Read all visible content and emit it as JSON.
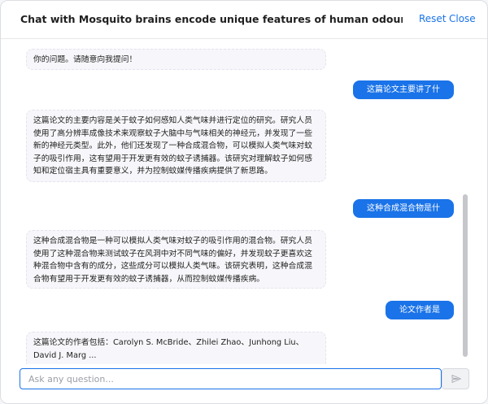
{
  "header": {
    "title": "Chat with Mosquito brains encode unique features of human odour to drive host seeking...",
    "reset_label": "Reset",
    "close_label": "Close"
  },
  "messages": [
    {
      "role": "assistant",
      "text": "你的问题。请随意向我提问！"
    },
    {
      "role": "user",
      "text": "这篇论文主要讲了什么？"
    },
    {
      "role": "assistant",
      "text": "这篇论文的主要内容是关于蚊子如何感知人类气味并进行定位的研究。研究人员使用了高分辨率成像技术来观察蚊子大脑中与气味相关的神经元，并发现了一些新的神经元类型。此外，他们还发现了一种合成混合物，可以模拟人类气味对蚊子的吸引作用，这有望用于开发更有效的蚊子诱捕器。该研究对理解蚊子如何感知和定位宿主具有重要意义，并为控制蚊媒传播疾病提供了新思路。"
    },
    {
      "role": "user",
      "text": "这种合成混合物是什么？"
    },
    {
      "role": "assistant",
      "text": "这种合成混合物是一种可以模拟人类气味对蚊子的吸引作用的混合物。研究人员使用了这种混合物来测试蚊子在风洞中对不同气味的偏好，并发现蚊子更喜欢这种混合物中含有的成分，这些成分可以模拟人类气味。该研究表明，这种合成混合物有望用于开发更有效的蚊子诱捕器，从而控制蚊媒传播疾病。"
    },
    {
      "role": "user",
      "text": "论文作者是谁？"
    },
    {
      "role": "assistant",
      "text": "这篇论文的作者包括：Carolyn S. McBride、Zhilei Zhao、Junhong Liu、David J. Marg ..."
    }
  ],
  "input": {
    "placeholder": "Ask any question...",
    "value": ""
  },
  "icons": {
    "send": "send-icon"
  },
  "colors": {
    "accent": "#1a73e8",
    "assistant_bubble": "#f7f7fb"
  }
}
